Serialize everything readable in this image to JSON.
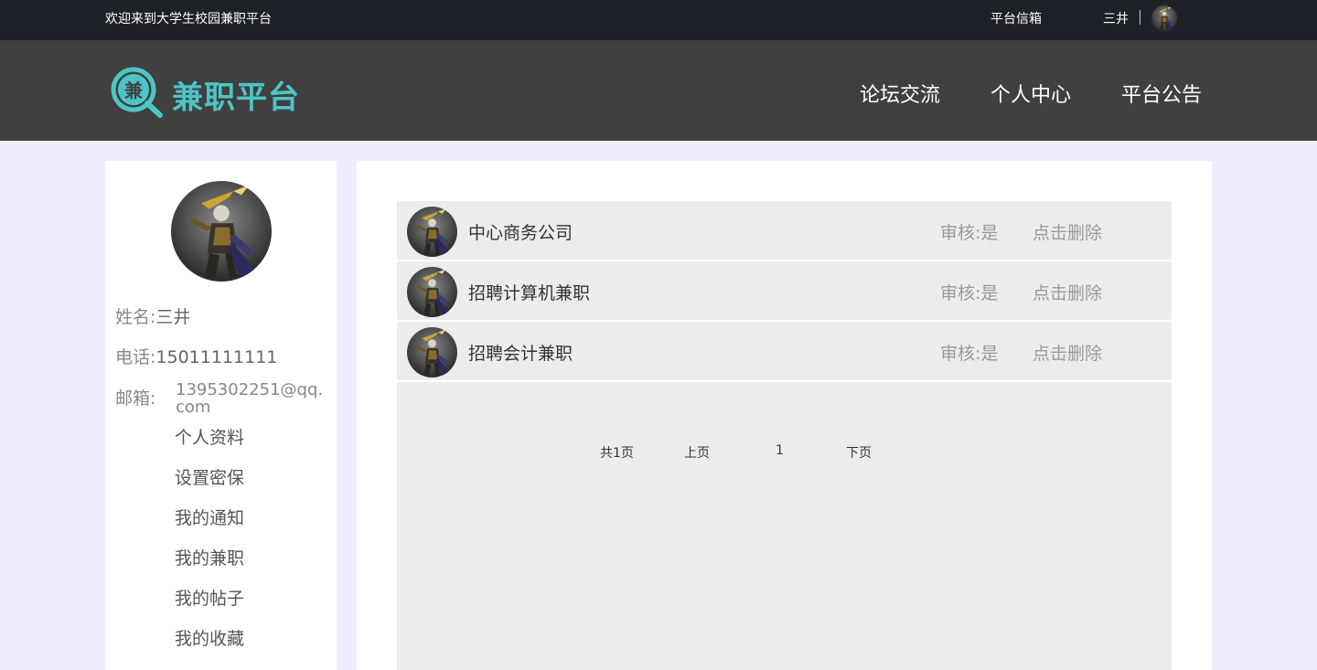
{
  "topbar": {
    "welcome": "欢迎来到大学生校园兼职平台",
    "mailbox": "平台信箱",
    "username": "三井"
  },
  "header": {
    "logo_glyph": "兼",
    "logo_text": "兼职平台",
    "nav": [
      "论坛交流",
      "个人中心",
      "平台公告"
    ]
  },
  "profile": {
    "name_label": "姓名:",
    "name": "三井",
    "phone_label": "电话:",
    "phone": "15011111111",
    "email_label": "邮箱:",
    "email": "1395302251@qq.com",
    "menu": [
      "个人资料",
      "设置密保",
      "我的通知",
      "我的兼职",
      "我的帖子",
      "我的收藏"
    ]
  },
  "list": {
    "items": [
      {
        "title": "中心商务公司",
        "audit": "审核:是",
        "delete": "点击删除"
      },
      {
        "title": "招聘计算机兼职",
        "audit": "审核:是",
        "delete": "点击删除"
      },
      {
        "title": "招聘会计兼职",
        "audit": "审核:是",
        "delete": "点击删除"
      }
    ]
  },
  "pagination": {
    "total": "共1页",
    "prev": "上页",
    "current": "1",
    "next": "下页"
  },
  "colors": {
    "topbar": "#1f2129",
    "header": "#404040",
    "accent": "#4cc5c5",
    "page_bg": "#efedfd"
  }
}
